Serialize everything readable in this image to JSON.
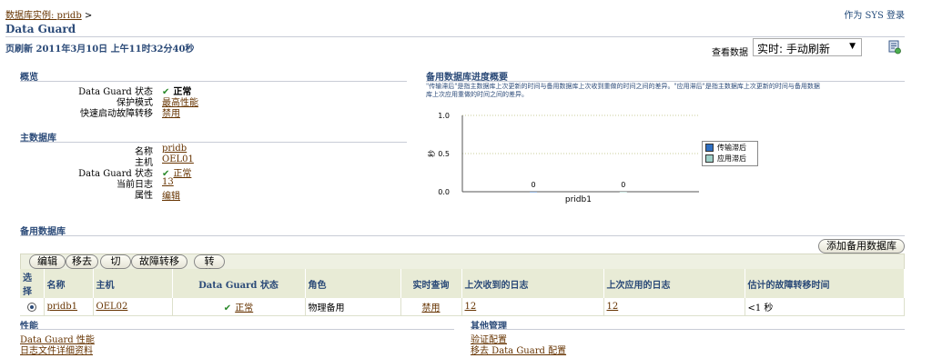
{
  "breadcrumb": {
    "link": "数据库实例: pridb",
    "sep": ">"
  },
  "header": {
    "login": "作为 SYS 登录",
    "title": "Data Guard",
    "refresh": "页刷新 2011年3月10日 上午11时32分40秒"
  },
  "view": {
    "label": "查看数据",
    "selected": "实时: 手动刷新"
  },
  "overview": {
    "title": "概览",
    "dg_status_label": "Data Guard 状态",
    "dg_status": "正常",
    "protection_label": "保护模式",
    "protection": "最高性能",
    "fsfo_label": "快速启动故障转移",
    "fsfo": "禁用"
  },
  "primary": {
    "title": "主数据库",
    "name_label": "名称",
    "name": "pridb",
    "host_label": "主机",
    "host": "OEL01",
    "status_label": "Data Guard 状态",
    "status": "正常",
    "log_label": "当前日志",
    "log": "13",
    "prop_label": "属性",
    "prop": "编辑"
  },
  "progress": {
    "title": "备用数据库进度概要",
    "desc_line1": "\"传输滞后\"是指主数据库上次更新的时间与备用数据库上次收到重做的时间之间的差异。\"应用滞后\"是指主数据库上次更新的时间与备用数据",
    "desc_line2": "库上次应用重做的时间之间的差异。"
  },
  "chart_data": {
    "type": "bar",
    "categories": [
      "pridb1"
    ],
    "series": [
      {
        "name": "传输滞后",
        "values": [
          0
        ],
        "color": "#2f6fc2"
      },
      {
        "name": "应用滞后",
        "values": [
          0
        ],
        "color": "#9fd0c8"
      }
    ],
    "ylabel": "秒",
    "ylim": [
      0,
      1
    ],
    "yticks": [
      "0.0",
      "0.5",
      "1.0"
    ],
    "data_labels": [
      "0",
      "0"
    ],
    "grid": true,
    "legend": "right"
  },
  "standby": {
    "title": "备用数据库",
    "add_button": "添加备用数据库",
    "buttons": [
      "编辑",
      "移去",
      "切换",
      "故障转移",
      "转换"
    ],
    "columns": [
      "选择",
      "名称",
      "主机",
      "Data Guard 状态",
      "角色",
      "实时查询",
      "上次收到的日志",
      "上次应用的日志",
      "估计的故障转移时间"
    ],
    "row": {
      "name": "pridb1",
      "host": "OEL02",
      "status": "正常",
      "role": "物理备用",
      "rtq": "禁用",
      "received": "12",
      "applied": "12",
      "failover": "<1 秒"
    }
  },
  "performance": {
    "title": "性能",
    "link1": "Data Guard 性能",
    "link2": "日志文件详细资料"
  },
  "other": {
    "title": "其他管理",
    "link1": "验证配置",
    "link2": "移去 Data Guard 配置"
  }
}
